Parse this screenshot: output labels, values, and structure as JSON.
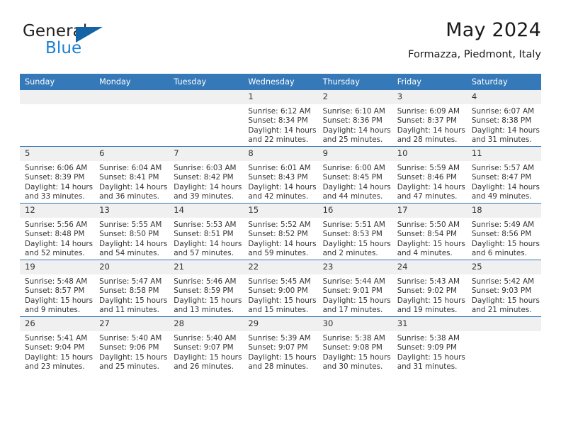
{
  "brand": {
    "line1": "General",
    "line2": "Blue",
    "triangle_color": "#1464a5",
    "blue_text_color": "#1c7fd0"
  },
  "header": {
    "title": "May 2024",
    "subtitle": "Formazza, Piedmont, Italy"
  },
  "theme": {
    "header_row_bg": "#3579b8",
    "header_row_text": "#ffffff",
    "daynum_bg": "#f0f0f0",
    "row_divider": "#3579b8",
    "body_text": "#333333"
  },
  "weekday_headers": [
    "Sunday",
    "Monday",
    "Tuesday",
    "Wednesday",
    "Thursday",
    "Friday",
    "Saturday"
  ],
  "labels": {
    "sunrise_prefix": "Sunrise: ",
    "sunset_prefix": "Sunset: ",
    "daylight_prefix": "Daylight: "
  },
  "weeks": [
    [
      {
        "day": "",
        "lines": []
      },
      {
        "day": "",
        "lines": []
      },
      {
        "day": "",
        "lines": []
      },
      {
        "day": "1",
        "lines": [
          "Sunrise: 6:12 AM",
          "Sunset: 8:34 PM",
          "Daylight: 14 hours",
          "and 22 minutes."
        ]
      },
      {
        "day": "2",
        "lines": [
          "Sunrise: 6:10 AM",
          "Sunset: 8:36 PM",
          "Daylight: 14 hours",
          "and 25 minutes."
        ]
      },
      {
        "day": "3",
        "lines": [
          "Sunrise: 6:09 AM",
          "Sunset: 8:37 PM",
          "Daylight: 14 hours",
          "and 28 minutes."
        ]
      },
      {
        "day": "4",
        "lines": [
          "Sunrise: 6:07 AM",
          "Sunset: 8:38 PM",
          "Daylight: 14 hours",
          "and 31 minutes."
        ]
      }
    ],
    [
      {
        "day": "5",
        "lines": [
          "Sunrise: 6:06 AM",
          "Sunset: 8:39 PM",
          "Daylight: 14 hours",
          "and 33 minutes."
        ]
      },
      {
        "day": "6",
        "lines": [
          "Sunrise: 6:04 AM",
          "Sunset: 8:41 PM",
          "Daylight: 14 hours",
          "and 36 minutes."
        ]
      },
      {
        "day": "7",
        "lines": [
          "Sunrise: 6:03 AM",
          "Sunset: 8:42 PM",
          "Daylight: 14 hours",
          "and 39 minutes."
        ]
      },
      {
        "day": "8",
        "lines": [
          "Sunrise: 6:01 AM",
          "Sunset: 8:43 PM",
          "Daylight: 14 hours",
          "and 42 minutes."
        ]
      },
      {
        "day": "9",
        "lines": [
          "Sunrise: 6:00 AM",
          "Sunset: 8:45 PM",
          "Daylight: 14 hours",
          "and 44 minutes."
        ]
      },
      {
        "day": "10",
        "lines": [
          "Sunrise: 5:59 AM",
          "Sunset: 8:46 PM",
          "Daylight: 14 hours",
          "and 47 minutes."
        ]
      },
      {
        "day": "11",
        "lines": [
          "Sunrise: 5:57 AM",
          "Sunset: 8:47 PM",
          "Daylight: 14 hours",
          "and 49 minutes."
        ]
      }
    ],
    [
      {
        "day": "12",
        "lines": [
          "Sunrise: 5:56 AM",
          "Sunset: 8:48 PM",
          "Daylight: 14 hours",
          "and 52 minutes."
        ]
      },
      {
        "day": "13",
        "lines": [
          "Sunrise: 5:55 AM",
          "Sunset: 8:50 PM",
          "Daylight: 14 hours",
          "and 54 minutes."
        ]
      },
      {
        "day": "14",
        "lines": [
          "Sunrise: 5:53 AM",
          "Sunset: 8:51 PM",
          "Daylight: 14 hours",
          "and 57 minutes."
        ]
      },
      {
        "day": "15",
        "lines": [
          "Sunrise: 5:52 AM",
          "Sunset: 8:52 PM",
          "Daylight: 14 hours",
          "and 59 minutes."
        ]
      },
      {
        "day": "16",
        "lines": [
          "Sunrise: 5:51 AM",
          "Sunset: 8:53 PM",
          "Daylight: 15 hours",
          "and 2 minutes."
        ]
      },
      {
        "day": "17",
        "lines": [
          "Sunrise: 5:50 AM",
          "Sunset: 8:54 PM",
          "Daylight: 15 hours",
          "and 4 minutes."
        ]
      },
      {
        "day": "18",
        "lines": [
          "Sunrise: 5:49 AM",
          "Sunset: 8:56 PM",
          "Daylight: 15 hours",
          "and 6 minutes."
        ]
      }
    ],
    [
      {
        "day": "19",
        "lines": [
          "Sunrise: 5:48 AM",
          "Sunset: 8:57 PM",
          "Daylight: 15 hours",
          "and 9 minutes."
        ]
      },
      {
        "day": "20",
        "lines": [
          "Sunrise: 5:47 AM",
          "Sunset: 8:58 PM",
          "Daylight: 15 hours",
          "and 11 minutes."
        ]
      },
      {
        "day": "21",
        "lines": [
          "Sunrise: 5:46 AM",
          "Sunset: 8:59 PM",
          "Daylight: 15 hours",
          "and 13 minutes."
        ]
      },
      {
        "day": "22",
        "lines": [
          "Sunrise: 5:45 AM",
          "Sunset: 9:00 PM",
          "Daylight: 15 hours",
          "and 15 minutes."
        ]
      },
      {
        "day": "23",
        "lines": [
          "Sunrise: 5:44 AM",
          "Sunset: 9:01 PM",
          "Daylight: 15 hours",
          "and 17 minutes."
        ]
      },
      {
        "day": "24",
        "lines": [
          "Sunrise: 5:43 AM",
          "Sunset: 9:02 PM",
          "Daylight: 15 hours",
          "and 19 minutes."
        ]
      },
      {
        "day": "25",
        "lines": [
          "Sunrise: 5:42 AM",
          "Sunset: 9:03 PM",
          "Daylight: 15 hours",
          "and 21 minutes."
        ]
      }
    ],
    [
      {
        "day": "26",
        "lines": [
          "Sunrise: 5:41 AM",
          "Sunset: 9:04 PM",
          "Daylight: 15 hours",
          "and 23 minutes."
        ]
      },
      {
        "day": "27",
        "lines": [
          "Sunrise: 5:40 AM",
          "Sunset: 9:06 PM",
          "Daylight: 15 hours",
          "and 25 minutes."
        ]
      },
      {
        "day": "28",
        "lines": [
          "Sunrise: 5:40 AM",
          "Sunset: 9:07 PM",
          "Daylight: 15 hours",
          "and 26 minutes."
        ]
      },
      {
        "day": "29",
        "lines": [
          "Sunrise: 5:39 AM",
          "Sunset: 9:07 PM",
          "Daylight: 15 hours",
          "and 28 minutes."
        ]
      },
      {
        "day": "30",
        "lines": [
          "Sunrise: 5:38 AM",
          "Sunset: 9:08 PM",
          "Daylight: 15 hours",
          "and 30 minutes."
        ]
      },
      {
        "day": "31",
        "lines": [
          "Sunrise: 5:38 AM",
          "Sunset: 9:09 PM",
          "Daylight: 15 hours",
          "and 31 minutes."
        ]
      },
      {
        "day": "",
        "lines": []
      }
    ]
  ]
}
